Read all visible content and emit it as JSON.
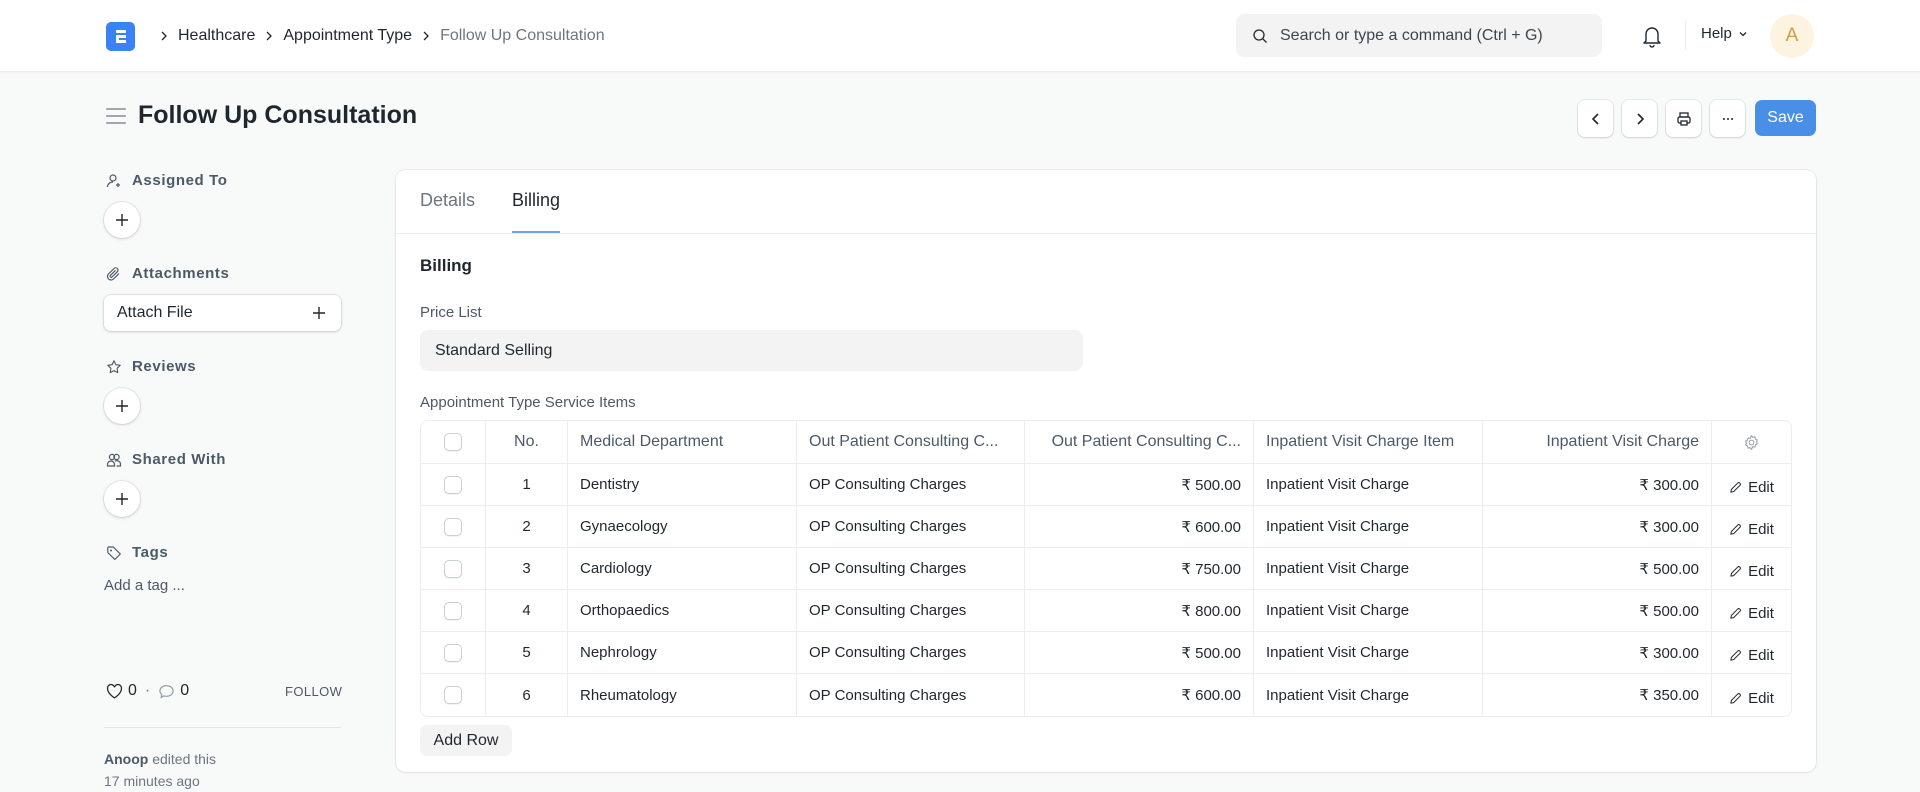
{
  "navbar": {
    "logo_letter": "E",
    "breadcrumbs": [
      "Healthcare",
      "Appointment Type",
      "Follow Up Consultation"
    ],
    "search_placeholder": "Search or type a command (Ctrl + G)",
    "help_label": "Help",
    "avatar_initial": "A",
    "colors": {
      "logo": "#3b82f6",
      "avatar_bg": "#fdf3e1",
      "avatar_text": "#d19d3e"
    }
  },
  "page": {
    "title": "Follow Up Consultation",
    "save_label": "Save",
    "accent_color": "#4a8fe7"
  },
  "sidebar": {
    "assigned_to_label": "Assigned To",
    "attachments_label": "Attachments",
    "attach_file_label": "Attach File",
    "reviews_label": "Reviews",
    "shared_with_label": "Shared With",
    "tags_label": "Tags",
    "add_tag_label": "Add a tag ...",
    "likes_count": "0",
    "comments_count": "0",
    "separator": "·",
    "follow_label": "FOLLOW",
    "activity_user": "Anoop",
    "activity_action": "edited this",
    "activity_time": "17 minutes ago"
  },
  "form": {
    "tabs": [
      {
        "label": "Details",
        "active": false
      },
      {
        "label": "Billing",
        "active": true
      }
    ],
    "section_title": "Billing",
    "price_list_label": "Price List",
    "price_list_value": "Standard Selling",
    "service_items_label": "Appointment Type Service Items",
    "add_row_label": "Add Row",
    "table": {
      "columns": [
        "No.",
        "Medical Department",
        "Out Patient Consulting C...",
        "Out Patient Consulting C...",
        "Inpatient Visit Charge Item",
        "Inpatient Visit Charge"
      ],
      "edit_label": "Edit",
      "rows": [
        {
          "no": "1",
          "department": "Dentistry",
          "op_item": "OP Consulting Charges",
          "op_charge": "₹ 500.00",
          "ip_item": "Inpatient Visit Charge",
          "ip_charge": "₹ 300.00"
        },
        {
          "no": "2",
          "department": "Gynaecology",
          "op_item": "OP Consulting Charges",
          "op_charge": "₹ 600.00",
          "ip_item": "Inpatient Visit Charge",
          "ip_charge": "₹ 300.00"
        },
        {
          "no": "3",
          "department": "Cardiology",
          "op_item": "OP Consulting Charges",
          "op_charge": "₹ 750.00",
          "ip_item": "Inpatient Visit Charge",
          "ip_charge": "₹ 500.00"
        },
        {
          "no": "4",
          "department": "Orthopaedics",
          "op_item": "OP Consulting Charges",
          "op_charge": "₹ 800.00",
          "ip_item": "Inpatient Visit Charge",
          "ip_charge": "₹ 500.00"
        },
        {
          "no": "5",
          "department": "Nephrology",
          "op_item": "OP Consulting Charges",
          "op_charge": "₹ 500.00",
          "ip_item": "Inpatient Visit Charge",
          "ip_charge": "₹ 300.00"
        },
        {
          "no": "6",
          "department": "Rheumatology",
          "op_item": "OP Consulting Charges",
          "op_charge": "₹ 600.00",
          "ip_item": "Inpatient Visit Charge",
          "ip_charge": "₹ 350.00"
        }
      ]
    }
  }
}
